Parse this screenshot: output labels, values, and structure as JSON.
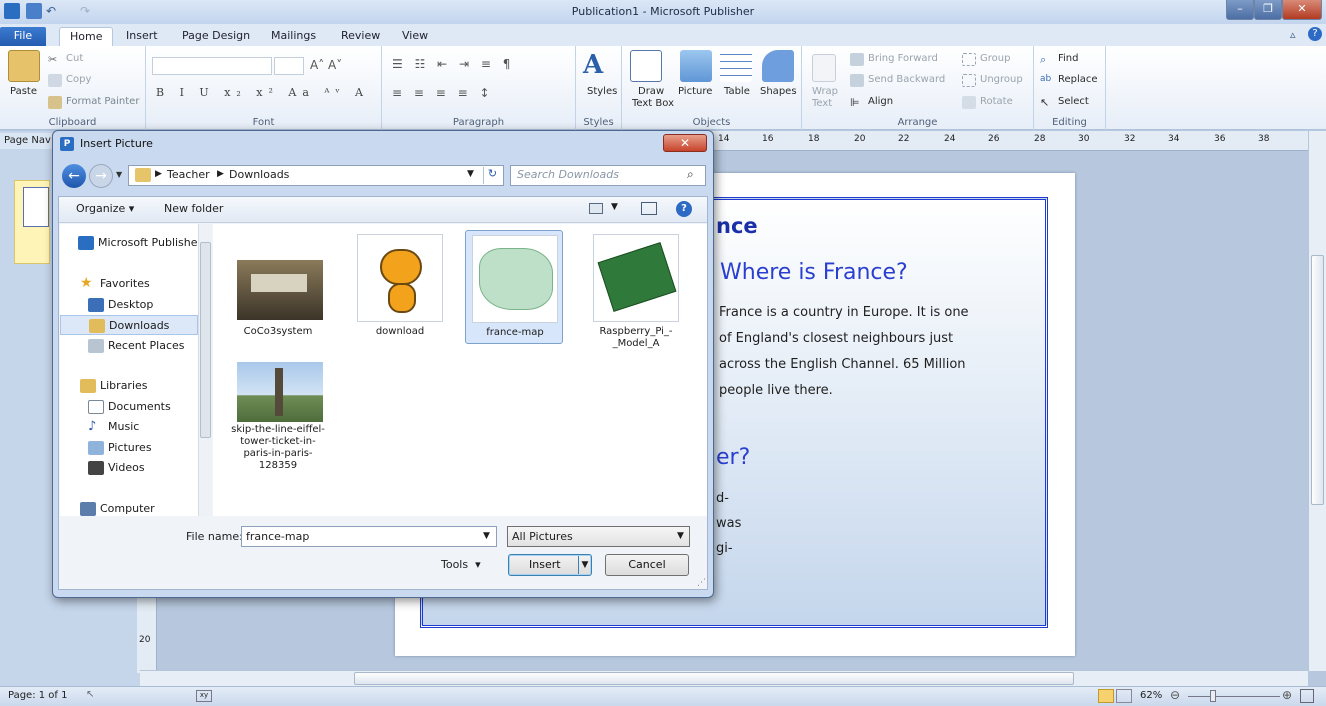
{
  "window": {
    "title": "Publication1 - Microsoft Publisher"
  },
  "tabs": [
    "File",
    "Home",
    "Insert",
    "Page Design",
    "Mailings",
    "Review",
    "View"
  ],
  "ribbon": {
    "clipboard": {
      "paste": "Paste",
      "cut": "Cut",
      "copy": "Copy",
      "format_painter": "Format Painter",
      "label": "Clipboard"
    },
    "font": {
      "label": "Font"
    },
    "paragraph": {
      "label": "Paragraph"
    },
    "styles": {
      "button": "Styles",
      "label": "Styles"
    },
    "objects": {
      "draw_text_box_1": "Draw",
      "draw_text_box_2": "Text Box",
      "picture": "Picture",
      "table": "Table",
      "shapes": "Shapes",
      "label": "Objects"
    },
    "arrange": {
      "wrap_1": "Wrap",
      "wrap_2": "Text",
      "bring_forward": "Bring Forward",
      "send_backward": "Send Backward",
      "align": "Align",
      "group": "Group",
      "ungroup": "Ungroup",
      "rotate": "Rotate",
      "label": "Arrange"
    },
    "editing": {
      "find": "Find",
      "replace": "Replace",
      "select": "Select",
      "label": "Editing"
    }
  },
  "left_pane": {
    "page_nav": "Page Nav"
  },
  "ruler": {
    "ticks": [
      "14",
      "16",
      "18",
      "20",
      "22",
      "24",
      "26",
      "28",
      "30",
      "32",
      "34",
      "36",
      "38"
    ]
  },
  "vruler": {
    "mark": "20"
  },
  "publication": {
    "title_fragment": "nce",
    "heading1": "Where is France?",
    "para1": [
      "France is a country in Europe. It is  one",
      "of England's closest neighbours just",
      "across the English Channel. 65 Million",
      "people live there."
    ],
    "heading2_fragment": "er?",
    "para2_fragments": [
      "d-",
      "was",
      "gi-"
    ]
  },
  "dialog": {
    "title": "Insert Picture",
    "breadcrumb": [
      "Teacher",
      "Downloads"
    ],
    "search_placeholder": "Search Downloads",
    "organize": "Organize",
    "new_folder": "New folder",
    "nav": [
      {
        "label": "Microsoft Publishe"
      },
      {
        "label": "Favorites"
      },
      {
        "label": "Desktop"
      },
      {
        "label": "Downloads"
      },
      {
        "label": "Recent Places"
      },
      {
        "label": "Libraries"
      },
      {
        "label": "Documents"
      },
      {
        "label": "Music"
      },
      {
        "label": "Pictures"
      },
      {
        "label": "Videos"
      },
      {
        "label": "Computer"
      }
    ],
    "files": [
      {
        "name": "CoCo3system"
      },
      {
        "name": "download"
      },
      {
        "name": "france-map"
      },
      {
        "name": "Raspberry_Pi_-_Model_A"
      },
      {
        "name": "skip-the-line-eiffel-tower-ticket-in-paris-in-paris-128359"
      }
    ],
    "file_name_label": "File name:",
    "file_name_value": "france-map",
    "filter": "All Pictures",
    "tools": "Tools",
    "insert": "Insert",
    "cancel": "Cancel"
  },
  "status": {
    "page": "Page: 1 of 1",
    "zoom": "62%"
  }
}
